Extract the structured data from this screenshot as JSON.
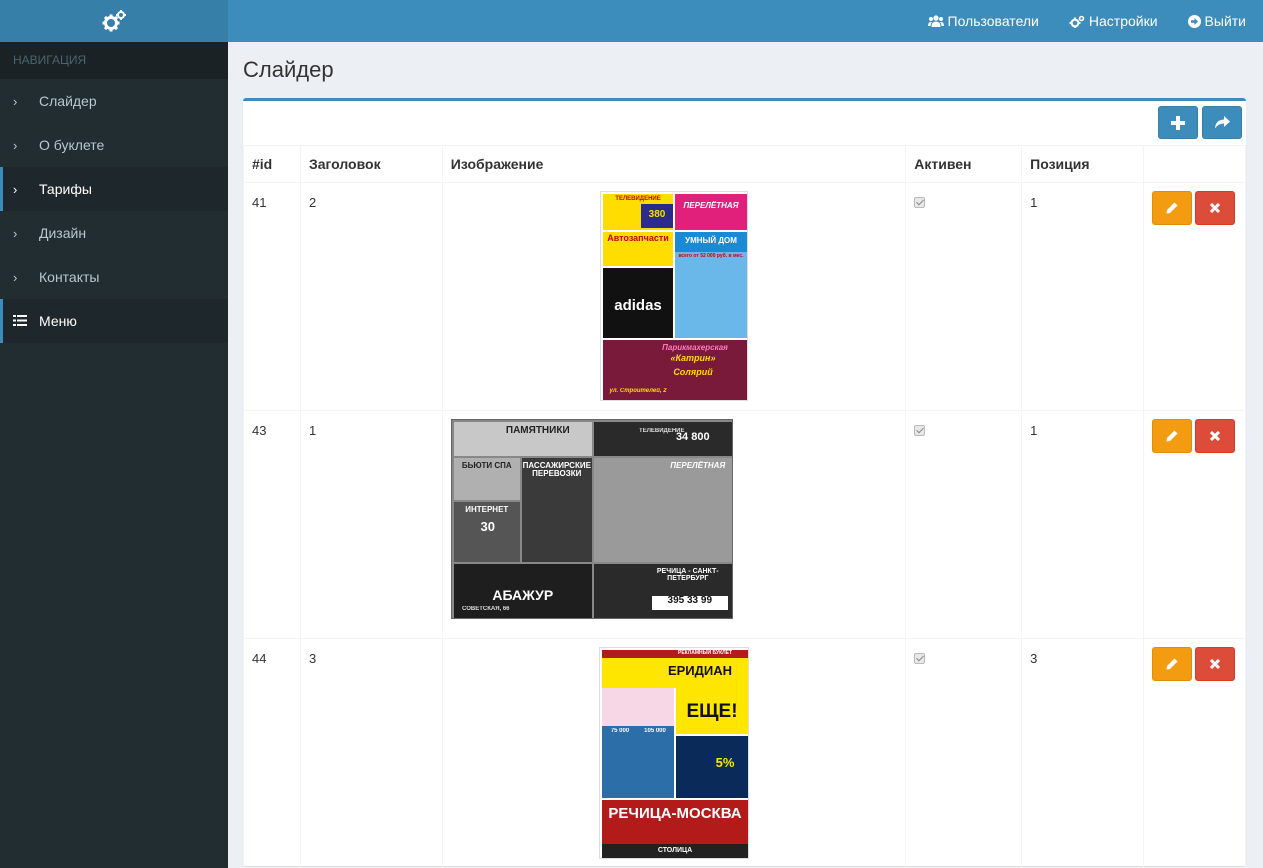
{
  "topbar": {
    "users_label": "Пользователи",
    "settings_label": "Настройки",
    "logout_label": "Выйти"
  },
  "sidebar": {
    "header": "НАВИГАЦИЯ",
    "items": [
      {
        "label": "Слайдер"
      },
      {
        "label": "О буклете"
      },
      {
        "label": "Тарифы"
      },
      {
        "label": "Дизайн"
      },
      {
        "label": "Контакты"
      },
      {
        "label": "Меню"
      }
    ]
  },
  "page": {
    "title": "Слайдер"
  },
  "table": {
    "headers": [
      "#id",
      "Заголовок",
      "Изображение",
      "Активен",
      "Позиция"
    ],
    "rows": [
      {
        "id": "41",
        "title": "2",
        "active": true,
        "position": "1"
      },
      {
        "id": "43",
        "title": "1",
        "active": true,
        "position": "1"
      },
      {
        "id": "44",
        "title": "3",
        "active": true,
        "position": "3"
      }
    ]
  },
  "images": {
    "img1": {
      "t1": "ТЕЛЕВИДЕНИЕ",
      "t2": "380",
      "t3": "ПЕРЕЛЁТНАЯ",
      "t4": "Автозапчасти",
      "t5": "УМНЫЙ ДОМ",
      "t6": "всего от 52 000 руб. в мес.",
      "t7": "adidas",
      "t8": "Парикмахерская",
      "t9": "«Катрин»",
      "t10": "Солярий",
      "t11": "ул. Строителей, 2"
    },
    "img2": {
      "t1": "ПАМЯТНИКИ",
      "t2": "34 800",
      "t3": "ТЕЛЕВИДЕНИЕ",
      "t4": "БЬЮТИ СПА",
      "t5": "ПАССАЖИРСКИЕ ПЕРЕВОЗКИ",
      "t6": "ПЕРЕЛЁТНАЯ",
      "t7": "ИНТЕРНЕТ",
      "t8": "30",
      "t9": "АБАЖУР",
      "t10": "РЕЧИЦА - САНКТ-ПЕТЕРБУРГ",
      "t11": "395 33 99",
      "t12": "СОВЕТСКАЯ, 66"
    },
    "img3": {
      "t1": "РЕКЛАМНЫЙ БУКЛЕТ",
      "t2": "ЕРИДИАН",
      "t3": "ЕЩЕ!",
      "t4": "75 000",
      "t5": "105 000",
      "t6": "5%",
      "t7": "РЕЧИЦА-МОСКВА",
      "t8": "СТОЛИЦА"
    }
  },
  "colors": {
    "primary": "#3c8dbc",
    "edit": "#f39c12",
    "delete": "#dd4b39",
    "sidebar": "#222d32"
  }
}
